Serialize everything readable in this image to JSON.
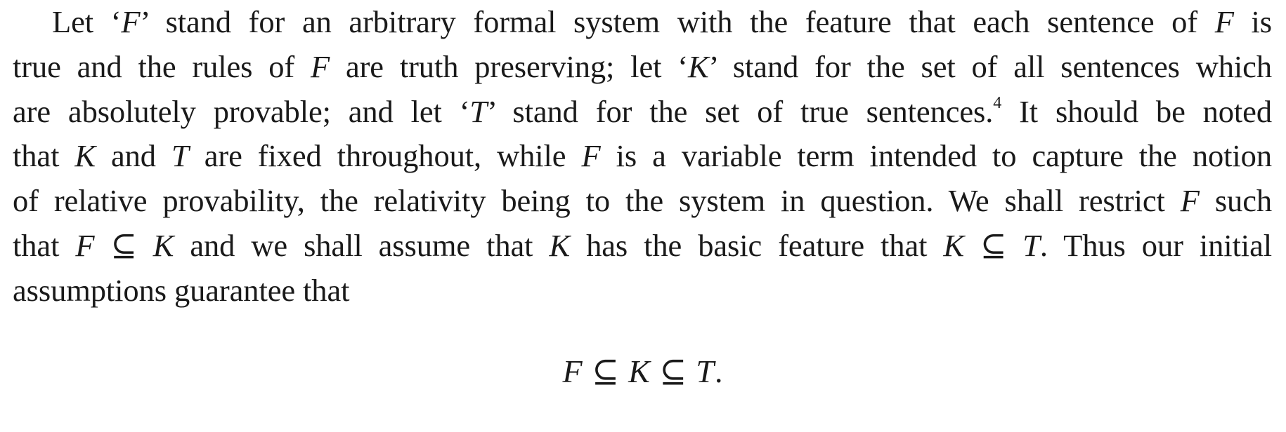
{
  "paragraph": {
    "lines": [
      {
        "segments": [
          {
            "t": "Let ‘",
            "m": false
          },
          {
            "t": "F",
            "m": true
          },
          {
            "t": "’ stand for an arbitrary formal system with the feature that each sentence of ",
            "m": false
          },
          {
            "t": "F",
            "m": true
          },
          {
            "t": " is",
            "m": false
          }
        ]
      },
      {
        "segments": [
          {
            "t": "true and the rules of ",
            "m": false
          },
          {
            "t": "F",
            "m": true
          },
          {
            "t": " are truth preserving; let ‘",
            "m": false
          },
          {
            "t": "K",
            "m": true
          },
          {
            "t": "’ stand for the set of all sentences which",
            "m": false
          }
        ]
      },
      {
        "segments": [
          {
            "t": "are absolutely provable; and let ‘",
            "m": false
          },
          {
            "t": "T",
            "m": true
          },
          {
            "t": "’ stand for the set of true sentences.",
            "m": false
          },
          {
            "t": "4",
            "m": false,
            "sup": true
          },
          {
            "t": " It should be noted",
            "m": false
          }
        ]
      },
      {
        "segments": [
          {
            "t": "that ",
            "m": false
          },
          {
            "t": "K",
            "m": true
          },
          {
            "t": " and ",
            "m": false
          },
          {
            "t": "T",
            "m": true
          },
          {
            "t": " are fixed throughout, while ",
            "m": false
          },
          {
            "t": "F",
            "m": true
          },
          {
            "t": " is a variable term intended to capture the notion",
            "m": false
          }
        ]
      },
      {
        "segments": [
          {
            "t": "of relative provability, the relativity being to the system in question. We shall restrict ",
            "m": false
          },
          {
            "t": "F",
            "m": true
          },
          {
            "t": " such",
            "m": false
          }
        ]
      },
      {
        "segments": [
          {
            "t": "that ",
            "m": false
          },
          {
            "t": "F",
            "m": true
          },
          {
            "t": " ⊆ ",
            "m": false
          },
          {
            "t": "K",
            "m": true
          },
          {
            "t": " and we shall assume that ",
            "m": false
          },
          {
            "t": "K",
            "m": true
          },
          {
            "t": " has the basic feature that ",
            "m": false
          },
          {
            "t": "K",
            "m": true
          },
          {
            "t": " ⊆ ",
            "m": false
          },
          {
            "t": "T",
            "m": true
          },
          {
            "t": ". Thus our initial",
            "m": false
          }
        ]
      },
      {
        "segments": [
          {
            "t": "assumptions guarantee that",
            "m": false
          }
        ]
      }
    ]
  },
  "display_formula": {
    "segments": [
      {
        "t": "F",
        "m": true
      },
      {
        "t": " ⊆ ",
        "m": false
      },
      {
        "t": "K",
        "m": true
      },
      {
        "t": " ⊆ ",
        "m": false
      },
      {
        "t": "T",
        "m": true
      },
      {
        "t": ".",
        "m": false
      }
    ]
  }
}
